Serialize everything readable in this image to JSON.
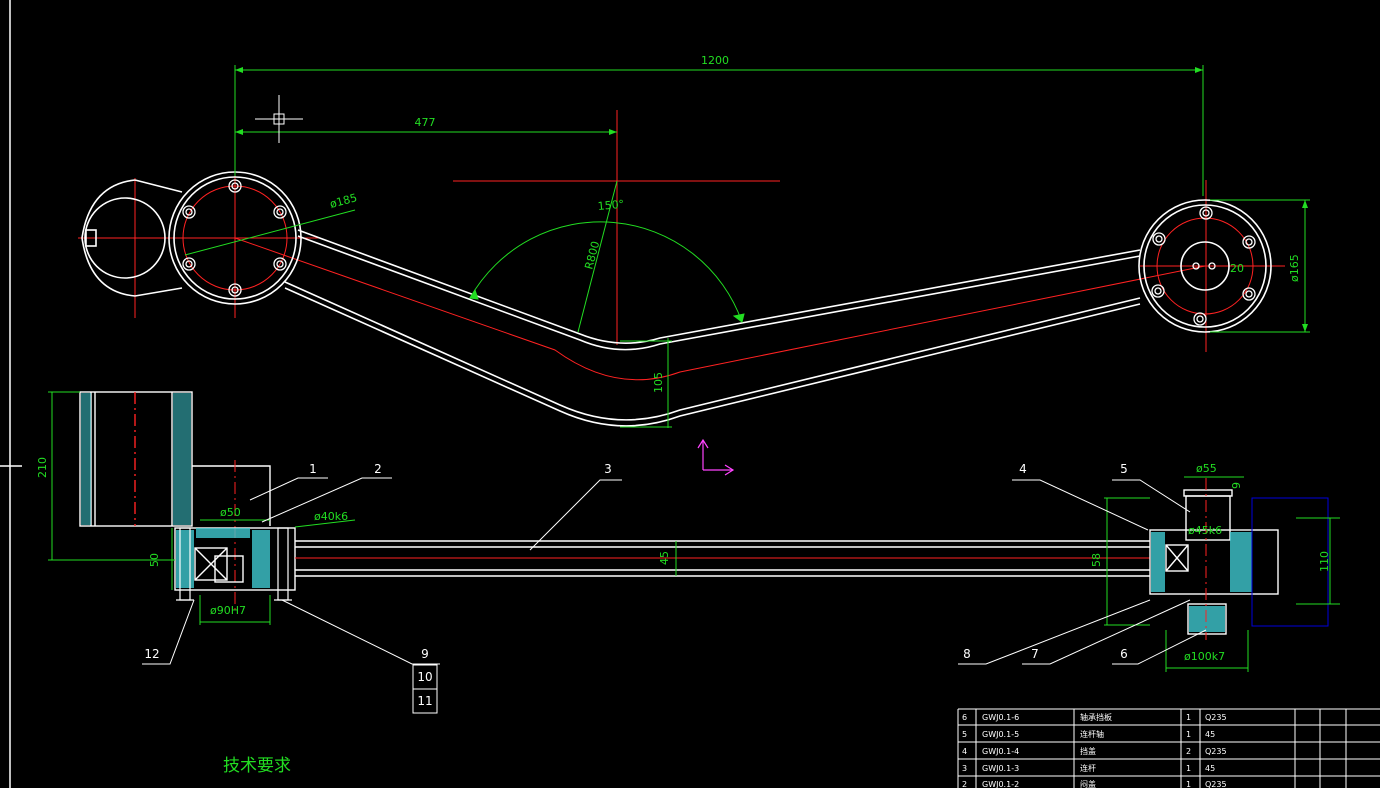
{
  "dimensions": {
    "total_length": "1200",
    "pivot_offset": "477",
    "left_flange_dia": "ø185",
    "bend_angle": "150°",
    "bend_radius": "R800",
    "arm_height": "105",
    "right_flange_dia": "ø165",
    "right_bolt_circle": "20",
    "housing_height": "210",
    "bore_dia": "ø50",
    "shaft_fit_left": "ø40k6",
    "flange_height": "50",
    "bearing_fit_left": "ø90H7",
    "tube_dia": "45",
    "right_housing_height": "58",
    "right_top_dia": "ø55",
    "right_gap": "9",
    "shaft_fit_right": "ø45k6",
    "right_flange_height": "110",
    "bearing_fit_right": "ø100k7"
  },
  "part_labels": [
    "1",
    "2",
    "3",
    "4",
    "5",
    "6",
    "7",
    "8",
    "9",
    "10",
    "11",
    "12"
  ],
  "technical_requirements": "技术要求",
  "title_block": [
    {
      "no": "6",
      "code": "GWJ0.1-6",
      "name": "轴承挡板",
      "qty": "1",
      "material": "Q235"
    },
    {
      "no": "5",
      "code": "GWJ0.1-5",
      "name": "连杆轴",
      "qty": "1",
      "material": "45"
    },
    {
      "no": "4",
      "code": "GWJ0.1-4",
      "name": "挡盖",
      "qty": "2",
      "material": "Q235"
    },
    {
      "no": "3",
      "code": "GWJ0.1-3",
      "name": "连杆",
      "qty": "1",
      "material": "45"
    },
    {
      "no": "2",
      "code": "GWJ0.1-2",
      "name": "闷盖",
      "qty": "1",
      "material": "Q235"
    }
  ],
  "colors": {
    "background": "#000000",
    "dimension": "#22dd22",
    "centerline": "#ff2222",
    "outline": "#ffffff",
    "section": "#40c8d0",
    "ucs": "#ff44ff"
  }
}
